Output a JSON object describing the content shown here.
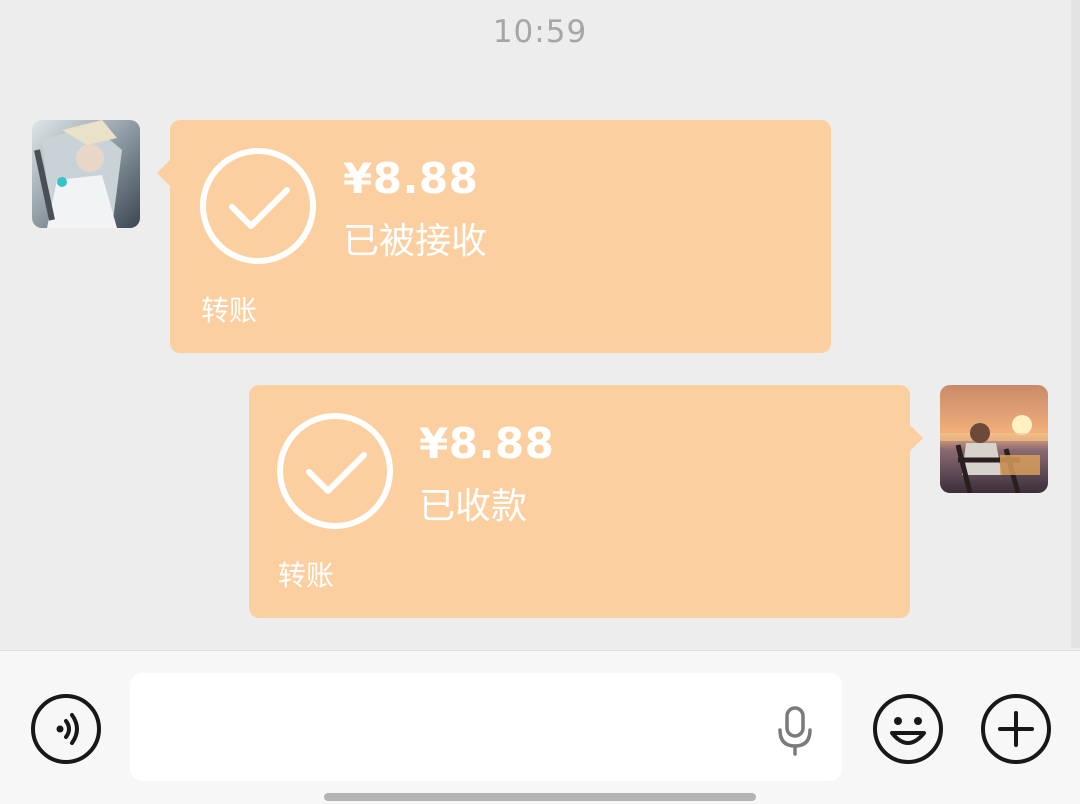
{
  "chat": {
    "timestamp": "10:59",
    "messages": [
      {
        "side": "left",
        "amount": "¥8.88",
        "status": "已被接收",
        "type_label": "转账",
        "avatar": "warrior-avatar"
      },
      {
        "side": "right",
        "amount": "¥8.88",
        "status": "已收款",
        "type_label": "转账",
        "avatar": "sunset-avatar"
      }
    ]
  },
  "input_bar": {
    "text_value": "",
    "icons": {
      "voice": "voice-icon",
      "mic": "microphone-icon",
      "emoji": "emoji-icon",
      "more": "plus-icon"
    }
  },
  "colors": {
    "background": "#ededed",
    "bubble": "#fbcfa0",
    "bubble_text": "#ffffff",
    "timestamp": "#a6a6a6"
  }
}
